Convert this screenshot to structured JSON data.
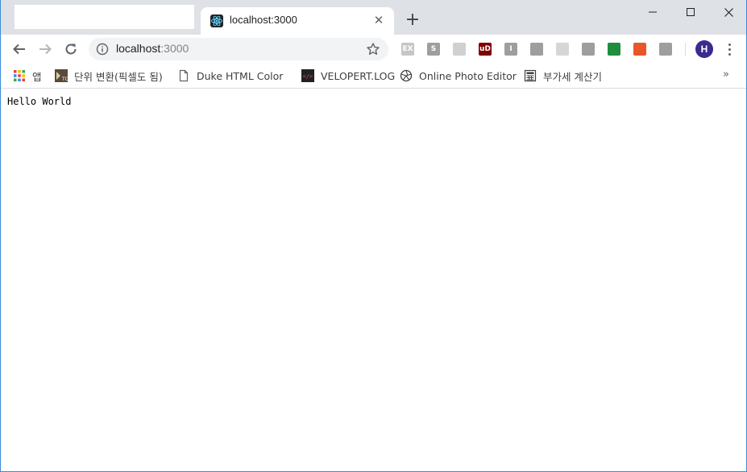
{
  "tab": {
    "title": "localhost:3000",
    "close_label": "✕"
  },
  "new_tab_label": "+",
  "omnibox": {
    "host": "localhost",
    "port": ":3000"
  },
  "profile": {
    "initial": "H"
  },
  "extensions": [
    {
      "icon": "ex-icon",
      "label": "EX",
      "color": "#c6c6c6"
    },
    {
      "icon": "s-icon",
      "label": "S",
      "color": "#9e9e9e"
    },
    {
      "icon": "target-icon",
      "label": "",
      "color": "#d0d0d0"
    },
    {
      "icon": "ublock-icon",
      "label": "uD",
      "color": "#800000"
    },
    {
      "icon": "i-icon",
      "label": "I",
      "color": "#9e9e9e"
    },
    {
      "icon": "vue-icon",
      "label": "",
      "color": "#9e9e9e"
    },
    {
      "icon": "react-devtools-icon",
      "label": "",
      "color": "#d6d6d6"
    },
    {
      "icon": "head-icon",
      "label": "",
      "color": "#9e9e9e"
    },
    {
      "icon": "utorrent-icon",
      "label": "",
      "color": "#1e8e3e"
    },
    {
      "icon": "orange-ext-icon",
      "label": "",
      "color": "#e8572a"
    },
    {
      "icon": "office-icon",
      "label": "",
      "color": "#9e9e9e"
    }
  ],
  "bookmarks": [
    {
      "label": "앱"
    },
    {
      "label": "단위 변환(픽셀도 됨)"
    },
    {
      "label": "Duke HTML Color v("
    },
    {
      "label": "VELOPERT.LOG"
    },
    {
      "label": "Online Photo Editor"
    },
    {
      "label": "부가세 계산기"
    }
  ],
  "bookmarks_more": "»",
  "page": {
    "text": "Hello World"
  }
}
